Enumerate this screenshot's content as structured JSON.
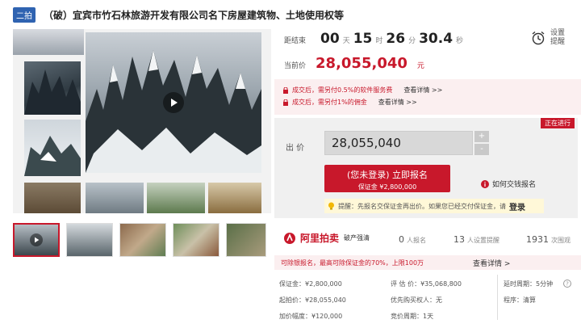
{
  "title": {
    "tag": "二拍",
    "text": "（破）宜宾市竹石林旅游开发有限公司名下房屋建筑物、土地使用权等"
  },
  "countdown": {
    "label": "距结束",
    "days": "00",
    "days_unit": "天",
    "hours": "15",
    "hours_unit": "时",
    "minutes": "26",
    "minutes_unit": "分",
    "seconds": "30.4",
    "seconds_unit": "秒"
  },
  "alarm": {
    "line1": "设置",
    "line2": "提醒"
  },
  "current": {
    "label": "当前价",
    "price": "28,055,040",
    "unit": "元"
  },
  "notices": [
    {
      "text": "成交后，需另付0.5%的软件服务费",
      "link": "查看详情 >>"
    },
    {
      "text": "成交后，需另付1%的佣金",
      "link": "查看详情 >>"
    }
  ],
  "status_badge": "正在进行",
  "bid": {
    "label": "出 价",
    "value": "28,055,040",
    "plus": "+",
    "minus": "-"
  },
  "register": {
    "line1": "(您未登录) 立即报名",
    "line2": "保证金 ¥2,800,000"
  },
  "howto": "如何交钱报名",
  "reminder": {
    "text": "提醒：先报名交保证金再出价。如果您已经交付保证金，请",
    "link": "登录"
  },
  "ali": {
    "logo": "阿里拍卖",
    "sub": "破产强清"
  },
  "stats": [
    {
      "num": "0",
      "label": "人报名"
    },
    {
      "num": "13",
      "label": "人设置提醒"
    },
    {
      "num": "1931",
      "label": "次围观"
    }
  ],
  "loan": {
    "text": "可除银报名，最高可除保证金的70%，上限100万",
    "link": "查看详情 >"
  },
  "info": {
    "deposit": "保证金：¥2,800,000",
    "start": "起拍价：¥28,055,040",
    "increment": "加价幅度：¥120,000",
    "appraisal": "评 估 价：¥35,068,800",
    "priority": "优先购买权人：无",
    "period": "竞价周期：1天",
    "delay": "延时周期：5分钟",
    "procedure": "程序：清算"
  },
  "colors": {
    "brand": "#c8182b",
    "tag": "#2f63b1"
  }
}
